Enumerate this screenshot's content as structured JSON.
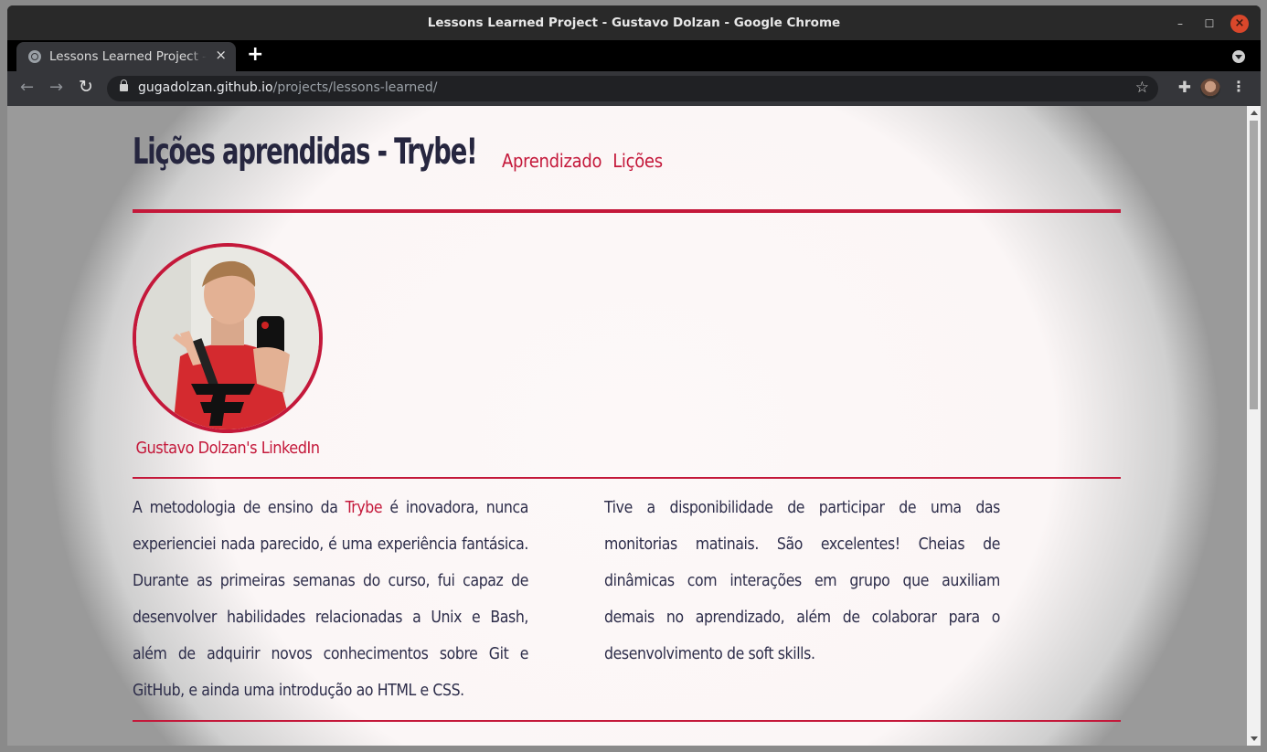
{
  "window": {
    "title": "Lessons Learned Project - Gustavo Dolzan - Google Chrome"
  },
  "tab": {
    "title": "Lessons Learned Project - Gustavo Dolzan",
    "close_icon": "×",
    "new_tab_icon": "+"
  },
  "address_bar": {
    "host": "gugadolzan.github.io",
    "path": "/projects/lessons-learned/"
  },
  "page": {
    "title": "Lições aprendidas - Trybe!",
    "nav": [
      "Aprendizado",
      "Lições"
    ],
    "profile_link": "Gustavo Dolzan's LinkedIn",
    "left_paragraph": {
      "before": "A metodologia de ensino da ",
      "highlight": "Trybe",
      "after": " é inovadora, nunca experienciei nada parecido, é uma experiência fantásica. Durante as primeiras semanas do curso, fui capaz de desenvolver habilidades relacionadas a Unix e Bash, além de adquirir novos conhecimentos sobre Git e GitHub, e ainda uma introdução ao HTML e CSS."
    },
    "right_paragraph": "Tive a disponibilidade de participar de uma das monitorias matinais. São excelentes! Cheias de dinâmicas com interações em grupo que auxiliam demais no aprendizado, além de colaborar para o desenvolvimento de soft skills."
  },
  "colors": {
    "accent": "#c4183a",
    "text": "#2d2d4a",
    "title": "#26263f"
  },
  "icons": {
    "back": "arrow-left-icon",
    "forward": "arrow-right-icon",
    "reload": "reload-icon",
    "lock": "lock-icon",
    "star": "star-icon",
    "extensions": "puzzle-icon",
    "menu": "kebab-menu-icon"
  }
}
